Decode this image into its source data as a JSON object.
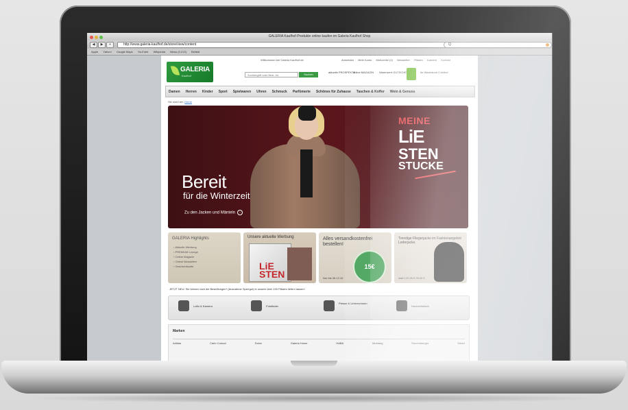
{
  "browser": {
    "window_title": "GALERIA Kaufhof-Produkte online kaufen im Galeria Kaufhof Shop",
    "url": "http://www.galeria-kaufhof.de/store/view/content",
    "bookmarks": [
      "Apple",
      "Yahoo!",
      "Google Maps",
      "YouTube",
      "Wikipedia",
      "News (3.213)",
      "Beliebt"
    ]
  },
  "site": {
    "welcome": "Willkommen bei Galeria Kaufhof.de",
    "top_links": [
      "Anmelden",
      "Mein Konto",
      "Merkzettel (0)",
      "Newsletter",
      "Filialen",
      "Karriere",
      "Kontakt"
    ],
    "logo_text": "GALERIA",
    "logo_sub": "Kaufhof",
    "search_placeholder": "Suchbegriff oder Best.-Nr.",
    "search_button": "Suchen",
    "promos": [
      "aktuelle PROSPEKTE",
      "online MAGAZIN",
      "Warenwert GUTSCHEIN"
    ],
    "cart": "Ihr Warenkorb 0 Artikel",
    "categories": [
      "Damen",
      "Herren",
      "Kinder",
      "Sport",
      "Spielwaren",
      "Uhren",
      "Schmuck",
      "Parfümerie",
      "Schönes für Zuhause",
      "Taschen & Koffer",
      "Wein & Genuss"
    ],
    "breadcrumb_prefix": "Sie sind hier:",
    "breadcrumb_link": "Home"
  },
  "hero": {
    "title": "Bereit",
    "subtitle": "für die Winterzeit",
    "link": "Zu den Jacken und Mänteln",
    "badge": [
      "MEINE",
      "LiE",
      "STEN",
      "STUCKE"
    ]
  },
  "teasers": {
    "highlights_title": "GALERIA Highlights",
    "highlights_items": [
      "Aktuelle Werbung",
      "PREMIUM Lounge",
      "Online Magazin",
      "Online Newsletter",
      "Geschenkkarte"
    ],
    "ad_title": "Unsere aktuelle Werbung",
    "ad_magazine": "LiE STEN",
    "verified_title": "Alles versandkostenfrei bestellen!",
    "verified_seal": "15€",
    "verified_foot": "Nur bis 06.12.10",
    "trend_title": "Trendige Fliegerjacke im Fashionangebot Lederjacke",
    "trend_foot": "statt 129,95 € 99,95 €"
  },
  "info_line": "JETZT NEU: Sie können sich die Bestellungen* (Ausnahme Sperrgut) in unsere über 100 Filialen liefern lassen!",
  "services": [
    "Lotto & Kamera",
    "Fotofinder",
    "Presse & Unternehmen",
    "Hochzeitstisch"
  ],
  "brands": {
    "title": "Marken",
    "row": [
      "Adidas",
      "Carlo Colucci",
      "Dolce",
      "Galeria Home",
      "HABA",
      "Mustang",
      "Ravensburger",
      "Smart"
    ]
  }
}
